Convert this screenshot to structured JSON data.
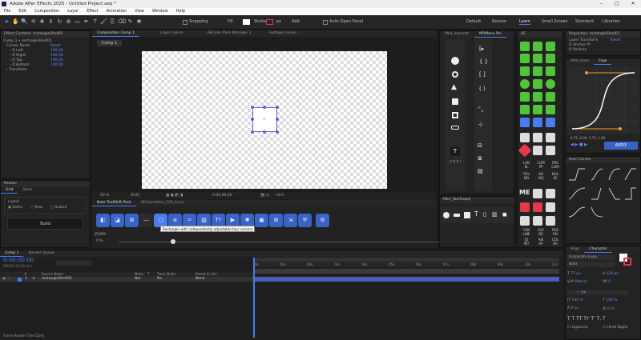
{
  "window": {
    "title": "Adobe After Effects 2025 - Untitled Project.aep *",
    "controls": [
      "–",
      "□",
      "✕"
    ]
  },
  "menu": [
    "File",
    "Edit",
    "Composition",
    "Layer",
    "Effect",
    "Animation",
    "View",
    "Window",
    "Help"
  ],
  "toolbar": {
    "snapping": "Snapping",
    "fill": "Fill",
    "stroke": "Stroke",
    "stroke_px": "px",
    "add": "Add",
    "auto_open": "Auto-Open Panel",
    "workspaces": [
      "Default",
      "Review",
      "Learn",
      "Small Screen",
      "Standard",
      "Libraries"
    ]
  },
  "effect_controls": {
    "tab": "Effect Controls: rectangleShell01",
    "comp": "Comp 1 • rectangleShell01",
    "rows": [
      {
        "name": "Corner Reset",
        "value": "Reset"
      },
      {
        "name": "Left",
        "value": "100.00"
      },
      {
        "name": "Right",
        "value": "100.00"
      },
      {
        "name": "Top",
        "value": "100.00"
      },
      {
        "name": "Bottom",
        "value": "100.00"
      },
      {
        "name": "Transform",
        "value": ""
      }
    ]
  },
  "resize": {
    "title": "Resizer",
    "tabs": [
      "Grid",
      "Sizes"
    ],
    "label": "Layout",
    "options": [
      "Same",
      "Row",
      "Scaled"
    ],
    "button": "Build"
  },
  "viewer": {
    "tabs": [
      "Composition Comp 1",
      "Layer (none)",
      "AEColor Pack Manager 3",
      "Footage (none)"
    ],
    "comp_label": "Comp 1",
    "zoom": "50 %",
    "quality": "(Full)",
    "timecode": "0:00:00:00",
    "plus": "+0.0"
  },
  "sidepanel": {
    "tabs": [
      "Mk4_Importer",
      "MRMenu Pnl"
    ],
    "extra_label": "テキスト",
    "shape_tab": "Mk4_ToolShape"
  },
  "toolpack": {
    "tabs": [
      "Note ToolShift Pack",
      "AEAnimation_CSS_Conv"
    ],
    "tooltip": "Rectangle with independently adjustable four corners",
    "zoom_label": "ZOOM",
    "zoom_pct": "0 %"
  },
  "layer_grid": {
    "labels": [
      [
        "LAB",
        "EL"
      ],
      [
        "COM",
        "PP"
      ],
      [
        "PRE",
        "COM"
      ],
      [
        "TOU",
        "ND"
      ],
      [
        "AD",
        "ADJ"
      ],
      [
        "NUL",
        "SE"
      ],
      [
        "CEN",
        "LINE"
      ],
      [
        "GUI",
        "DE"
      ],
      [
        "PGE",
        "RN"
      ],
      [
        "JO",
        "INT"
      ],
      [
        "AIE",
        "AP"
      ],
      [
        "COL",
        "OR"
      ]
    ],
    "text_label": "ME"
  },
  "props": {
    "title": "Properties: rectangleShell01",
    "layer_label": "Layer Transform",
    "reset": "Reset",
    "anchor": "Anchor Pt",
    "position": "Position"
  },
  "graph": {
    "title": "After Ease",
    "tab": "Flow",
    "values": "0.75, 0.00, 0.75, 1.00",
    "apply": "APPLY"
  },
  "curves_label": "User Curves",
  "character": {
    "tabs": [
      "Align",
      "Character"
    ],
    "font": "Corporate Logo",
    "style": "Bold",
    "size": "77 px",
    "leading": "120 px",
    "tracking": "0",
    "kern": "Metrics",
    "vert": "100 %",
    "horiz": "100 %",
    "baseline": "0 px",
    "tsume": "0 %",
    "ligatures": "Ligatures",
    "hindi": "Hindi Digits"
  },
  "timeline": {
    "tab": "Comp 1",
    "render": "Render Queue",
    "time": "0:00:00:00",
    "fps": "00000 (30.00 fps)",
    "headers": [
      "#",
      "Source Name",
      "Mode",
      "T",
      "Track Matte",
      "Parent & Link"
    ],
    "layer": {
      "num": "1",
      "name": "rectangleShell01",
      "mode": "Nor",
      "matte": "No",
      "parent": "None"
    },
    "ruler": [
      "0s",
      "01s",
      "02s",
      "03s",
      "04s",
      "05s",
      "06s",
      "07s",
      "08s",
      "09s",
      "10s",
      "11s"
    ],
    "footer": "Frame Render Time  12ms"
  }
}
